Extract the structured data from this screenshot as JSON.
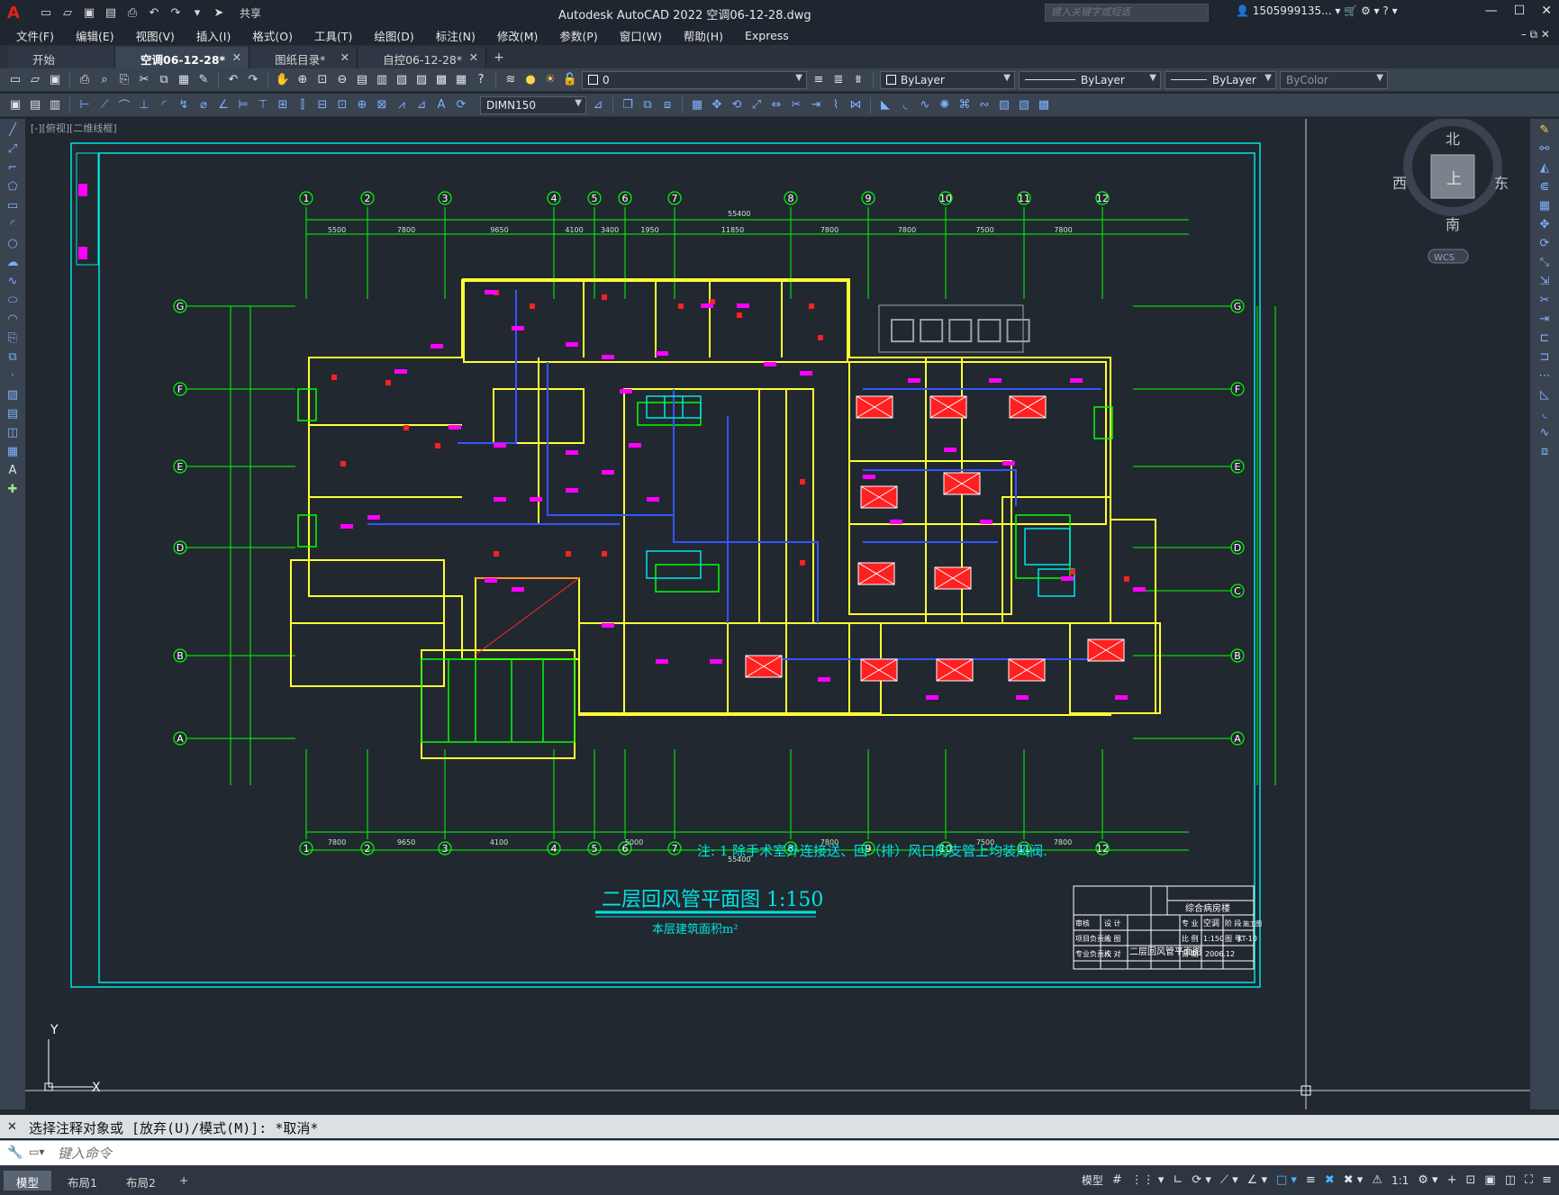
{
  "window": {
    "title": "Autodesk AutoCAD 2022    空调06-12-28.dwg",
    "search_placeholder": "键入关键字或短语",
    "user": "1505999135...",
    "share": "共享"
  },
  "menu": [
    "文件(F)",
    "编辑(E)",
    "视图(V)",
    "插入(I)",
    "格式(O)",
    "工具(T)",
    "绘图(D)",
    "标注(N)",
    "修改(M)",
    "参数(P)",
    "窗口(W)",
    "帮助(H)",
    "Express"
  ],
  "tabs": [
    {
      "label": "开始",
      "active": false,
      "closable": false
    },
    {
      "label": "空调06-12-28*",
      "active": true,
      "closable": true
    },
    {
      "label": "图纸目录*",
      "active": false,
      "closable": true
    },
    {
      "label": "自控06-12-28*",
      "active": false,
      "closable": true
    }
  ],
  "properties": {
    "layer": "0",
    "color": "ByLayer",
    "linetype": "ByLayer",
    "lineweight": "ByLayer",
    "plotstyle": "ByColor",
    "dimstyle": "DIMN150"
  },
  "viewport": {
    "label": "[-][俯视][二维线框]",
    "compass": {
      "n": "北",
      "s": "南",
      "e": "东",
      "w": "西",
      "top": "上",
      "wcs": "WCS"
    },
    "ucs_x": "X",
    "ucs_y": "Y"
  },
  "drawing": {
    "grid_cols": [
      "1",
      "2",
      "3",
      "4",
      "5",
      "6",
      "7",
      "8",
      "9",
      "10",
      "11",
      "12"
    ],
    "grid_rows": [
      "G",
      "F",
      "E",
      "D",
      "C",
      "B",
      "A"
    ],
    "dims_top": [
      "5500",
      "7800",
      "9650",
      "4100",
      "3400",
      "1950",
      "11850",
      "7800",
      "7800",
      "7500",
      "7800"
    ],
    "dim_total_top": "55400",
    "dims_bottom": [
      "7800",
      "9650",
      "4100",
      "5000",
      "7800",
      "7500",
      "7800"
    ],
    "dim_total_bottom": "55400",
    "placeholder_boxes": "□□□□□",
    "note": "注: 1 除手术室外连接送、回（排）风口的支管上均装风阀.",
    "title": "二层回风管平面图   1:150",
    "subtitle": "本层建筑面积m²",
    "titleblock": {
      "project": "综合病房楼",
      "sheet_name": "二层回风管平面图",
      "discipline_label": "专 业",
      "discipline": "空调",
      "stage_label": "阶 段",
      "stage": "施工图",
      "scale_label": "比 例",
      "scale": "1:150",
      "drawing_no_label": "图 号",
      "drawing_no": "KT-10",
      "date_label": "日 期",
      "date": "2006.12",
      "rows": [
        "审核",
        "项目负责人",
        "专业负责人"
      ],
      "rows2": [
        "设 计",
        "绘 图",
        "校 对"
      ]
    }
  },
  "command": {
    "history": "选择注释对象或 [放弃(U)/模式(M)]: *取消*",
    "placeholder": "键入命令"
  },
  "status": {
    "layout_tabs": [
      "模型",
      "布局1",
      "布局2"
    ],
    "model_label": "模型",
    "scale": "1:1"
  }
}
